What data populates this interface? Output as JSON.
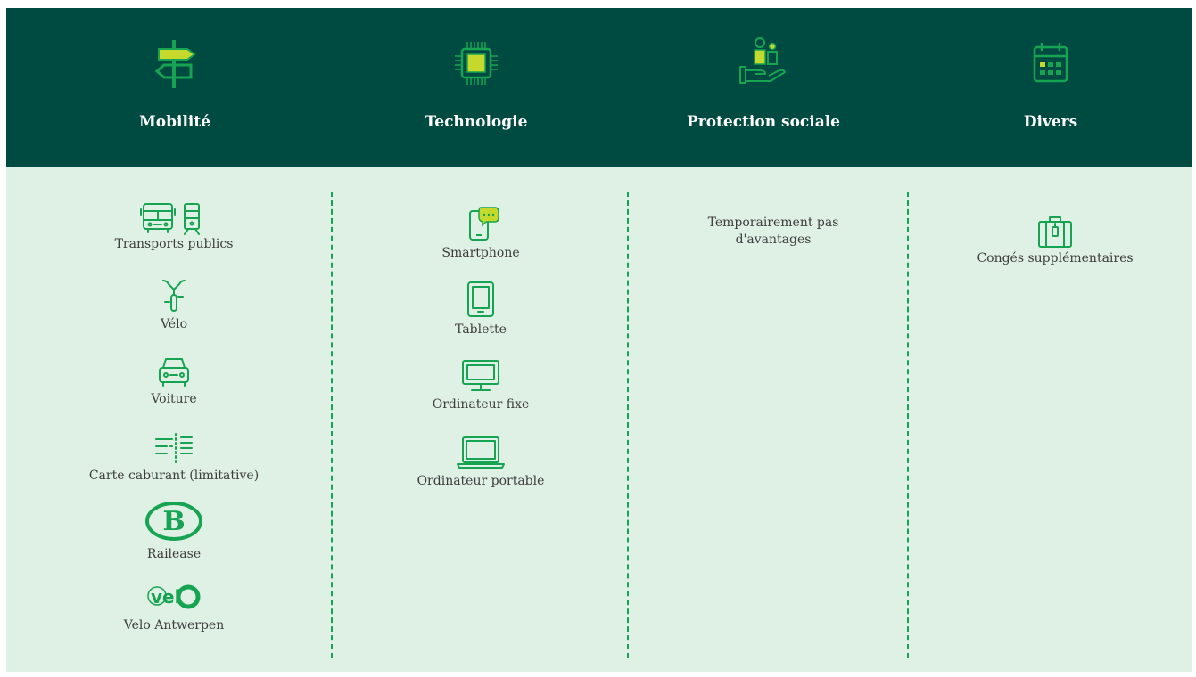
{
  "header": {
    "columns": [
      {
        "title": "Mobilité",
        "icon": "signpost-icon"
      },
      {
        "title": "Technologie",
        "icon": "chip-icon"
      },
      {
        "title": "Protection sociale",
        "icon": "hand-people-icon"
      },
      {
        "title": "Divers",
        "icon": "calendar-icon"
      }
    ]
  },
  "mobilite": {
    "items": [
      {
        "label": "Transports publics",
        "icon": "bus-tram-icon"
      },
      {
        "label": "Vélo",
        "icon": "bicycle-icon"
      },
      {
        "label": "Voiture",
        "icon": "car-icon"
      },
      {
        "label": "Carte caburant (limitative)",
        "icon": "fuel-card-icon"
      },
      {
        "label": "Railease",
        "icon": "sncb-logo-icon"
      },
      {
        "label": "Velo Antwerpen",
        "icon": "velo-antwerpen-logo-icon"
      }
    ]
  },
  "technologie": {
    "items": [
      {
        "label": "Smartphone",
        "icon": "smartphone-icon"
      },
      {
        "label": "Tablette",
        "icon": "tablet-icon"
      },
      {
        "label": "Ordinateur fixe",
        "icon": "desktop-icon"
      },
      {
        "label": "Ordinateur portable",
        "icon": "laptop-icon"
      }
    ]
  },
  "protection": {
    "note": "Temporairement pas d'avantages"
  },
  "divers": {
    "items": [
      {
        "label": "Congés supplémentaires",
        "icon": "suitcase-icon"
      }
    ]
  },
  "colors": {
    "header_bg": "#004b41",
    "body_bg": "#dff0e4",
    "accent_green": "#17a452",
    "accent_lime": "#c5d92d",
    "text": "#3d3d3d"
  }
}
